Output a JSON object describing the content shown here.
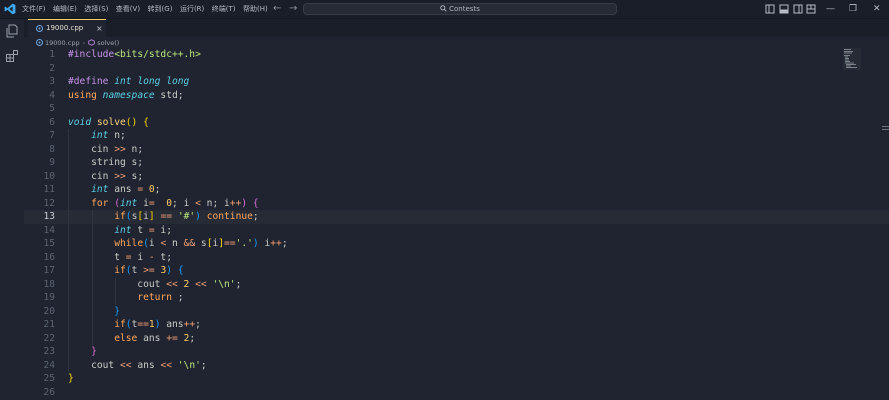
{
  "menu": [
    "文件(F)",
    "编辑(E)",
    "选择(S)",
    "查看(V)",
    "转到(G)",
    "运行(R)",
    "终端(T)",
    "帮助(H)"
  ],
  "search": {
    "label": "Contests"
  },
  "tab": {
    "filename": "19000.cpp",
    "close": "×"
  },
  "breadcrumb": {
    "file": "19000.cpp",
    "separator": "›",
    "symbol": "solve()"
  },
  "current_line": 13,
  "colors": {
    "accent": "#ffcc66",
    "background": "#1f2430"
  },
  "code": [
    {
      "n": "1",
      "t": [
        {
          "c": "t-pre",
          "v": "#include"
        },
        {
          "c": "t-inc",
          "v": "<bits/stdc++.h>"
        }
      ]
    },
    {
      "n": "2",
      "t": []
    },
    {
      "n": "3",
      "t": [
        {
          "c": "t-pre",
          "v": "#define "
        },
        {
          "c": "t-type",
          "v": "int"
        },
        {
          "c": "",
          "v": " "
        },
        {
          "c": "t-type",
          "v": "long long"
        }
      ]
    },
    {
      "n": "4",
      "t": [
        {
          "c": "t-kw",
          "v": "using"
        },
        {
          "c": "",
          "v": " "
        },
        {
          "c": "t-type",
          "v": "namespace"
        },
        {
          "c": "",
          "v": " std;"
        }
      ]
    },
    {
      "n": "5",
      "t": []
    },
    {
      "n": "6",
      "t": [
        {
          "c": "t-type",
          "v": "void"
        },
        {
          "c": "",
          "v": " "
        },
        {
          "c": "t-fn",
          "v": "solve"
        },
        {
          "c": "t-br1",
          "v": "()"
        },
        {
          "c": "",
          "v": " "
        },
        {
          "c": "t-br1",
          "v": "{"
        }
      ]
    },
    {
      "n": "7",
      "t": [
        {
          "c": "",
          "v": "    "
        },
        {
          "c": "t-type",
          "v": "int"
        },
        {
          "c": "",
          "v": " n;"
        }
      ]
    },
    {
      "n": "8",
      "t": [
        {
          "c": "",
          "v": "    cin "
        },
        {
          "c": "t-op",
          "v": ">>"
        },
        {
          "c": "",
          "v": " n;"
        }
      ]
    },
    {
      "n": "9",
      "t": [
        {
          "c": "",
          "v": "    string s;"
        }
      ]
    },
    {
      "n": "10",
      "t": [
        {
          "c": "",
          "v": "    cin "
        },
        {
          "c": "t-op",
          "v": ">>"
        },
        {
          "c": "",
          "v": " s;"
        }
      ]
    },
    {
      "n": "11",
      "t": [
        {
          "c": "",
          "v": "    "
        },
        {
          "c": "t-type",
          "v": "int"
        },
        {
          "c": "",
          "v": " ans "
        },
        {
          "c": "t-op",
          "v": "="
        },
        {
          "c": "",
          "v": " "
        },
        {
          "c": "t-num",
          "v": "0"
        },
        {
          "c": "",
          "v": ";"
        }
      ]
    },
    {
      "n": "12",
      "t": [
        {
          "c": "",
          "v": "    "
        },
        {
          "c": "t-kw",
          "v": "for"
        },
        {
          "c": "",
          "v": " "
        },
        {
          "c": "t-br2",
          "v": "("
        },
        {
          "c": "t-type",
          "v": "int"
        },
        {
          "c": "",
          "v": " i"
        },
        {
          "c": "t-op",
          "v": "="
        },
        {
          "c": "",
          "v": "  "
        },
        {
          "c": "t-num",
          "v": "0"
        },
        {
          "c": "",
          "v": "; i "
        },
        {
          "c": "t-op",
          "v": "<"
        },
        {
          "c": "",
          "v": " n; i"
        },
        {
          "c": "t-op",
          "v": "++"
        },
        {
          "c": "t-br2",
          "v": ")"
        },
        {
          "c": "",
          "v": " "
        },
        {
          "c": "t-br2",
          "v": "{"
        }
      ]
    },
    {
      "n": "13",
      "t": [
        {
          "c": "",
          "v": "        "
        },
        {
          "c": "t-kw",
          "v": "if"
        },
        {
          "c": "t-br3",
          "v": "("
        },
        {
          "c": "",
          "v": "s"
        },
        {
          "c": "t-br1",
          "v": "["
        },
        {
          "c": "",
          "v": "i"
        },
        {
          "c": "t-br1",
          "v": "]"
        },
        {
          "c": "",
          "v": " "
        },
        {
          "c": "t-op",
          "v": "=="
        },
        {
          "c": "",
          "v": " "
        },
        {
          "c": "t-str",
          "v": "'#'"
        },
        {
          "c": "t-br3",
          "v": ")"
        },
        {
          "c": "",
          "v": " "
        },
        {
          "c": "t-kw",
          "v": "continue"
        },
        {
          "c": "",
          "v": ";"
        }
      ]
    },
    {
      "n": "14",
      "t": [
        {
          "c": "",
          "v": "        "
        },
        {
          "c": "t-type",
          "v": "int"
        },
        {
          "c": "",
          "v": " t "
        },
        {
          "c": "t-op",
          "v": "="
        },
        {
          "c": "",
          "v": " i;"
        }
      ]
    },
    {
      "n": "15",
      "t": [
        {
          "c": "",
          "v": "        "
        },
        {
          "c": "t-kw",
          "v": "while"
        },
        {
          "c": "t-br3",
          "v": "("
        },
        {
          "c": "",
          "v": "i "
        },
        {
          "c": "t-op",
          "v": "<"
        },
        {
          "c": "",
          "v": " n "
        },
        {
          "c": "t-op",
          "v": "&&"
        },
        {
          "c": "",
          "v": " s"
        },
        {
          "c": "t-br1",
          "v": "["
        },
        {
          "c": "",
          "v": "i"
        },
        {
          "c": "t-br1",
          "v": "]"
        },
        {
          "c": "t-op",
          "v": "=="
        },
        {
          "c": "t-str",
          "v": "'.'"
        },
        {
          "c": "t-br3",
          "v": ")"
        },
        {
          "c": "",
          "v": " i"
        },
        {
          "c": "t-op",
          "v": "++"
        },
        {
          "c": "",
          "v": ";"
        }
      ]
    },
    {
      "n": "16",
      "t": [
        {
          "c": "",
          "v": "        t "
        },
        {
          "c": "t-op",
          "v": "="
        },
        {
          "c": "",
          "v": " i "
        },
        {
          "c": "t-op",
          "v": "-"
        },
        {
          "c": "",
          "v": " t;"
        }
      ]
    },
    {
      "n": "17",
      "t": [
        {
          "c": "",
          "v": "        "
        },
        {
          "c": "t-kw",
          "v": "if"
        },
        {
          "c": "t-br3",
          "v": "("
        },
        {
          "c": "",
          "v": "t "
        },
        {
          "c": "t-op",
          "v": ">="
        },
        {
          "c": "",
          "v": " "
        },
        {
          "c": "t-num",
          "v": "3"
        },
        {
          "c": "t-br3",
          "v": ")"
        },
        {
          "c": "",
          "v": " "
        },
        {
          "c": "t-br3",
          "v": "{"
        }
      ]
    },
    {
      "n": "18",
      "t": [
        {
          "c": "",
          "v": "            cout "
        },
        {
          "c": "t-op",
          "v": "<<"
        },
        {
          "c": "",
          "v": " "
        },
        {
          "c": "t-num",
          "v": "2"
        },
        {
          "c": "",
          "v": " "
        },
        {
          "c": "t-op",
          "v": "<<"
        },
        {
          "c": "",
          "v": " "
        },
        {
          "c": "t-str",
          "v": "'\\n'"
        },
        {
          "c": "",
          "v": ";"
        }
      ]
    },
    {
      "n": "19",
      "t": [
        {
          "c": "",
          "v": "            "
        },
        {
          "c": "t-kw",
          "v": "return"
        },
        {
          "c": "",
          "v": " ;"
        }
      ]
    },
    {
      "n": "20",
      "t": [
        {
          "c": "",
          "v": "        "
        },
        {
          "c": "t-br3",
          "v": "}"
        }
      ]
    },
    {
      "n": "21",
      "t": [
        {
          "c": "",
          "v": "        "
        },
        {
          "c": "t-kw",
          "v": "if"
        },
        {
          "c": "t-br3",
          "v": "("
        },
        {
          "c": "",
          "v": "t"
        },
        {
          "c": "t-op",
          "v": "=="
        },
        {
          "c": "t-num",
          "v": "1"
        },
        {
          "c": "t-br3",
          "v": ")"
        },
        {
          "c": "",
          "v": " ans"
        },
        {
          "c": "t-op",
          "v": "++"
        },
        {
          "c": "",
          "v": ";"
        }
      ]
    },
    {
      "n": "22",
      "t": [
        {
          "c": "",
          "v": "        "
        },
        {
          "c": "t-kw",
          "v": "else"
        },
        {
          "c": "",
          "v": " ans "
        },
        {
          "c": "t-op",
          "v": "+="
        },
        {
          "c": "",
          "v": " "
        },
        {
          "c": "t-num",
          "v": "2"
        },
        {
          "c": "",
          "v": ";"
        }
      ]
    },
    {
      "n": "23",
      "t": [
        {
          "c": "",
          "v": "    "
        },
        {
          "c": "t-br2",
          "v": "}"
        }
      ]
    },
    {
      "n": "24",
      "t": [
        {
          "c": "",
          "v": "    cout "
        },
        {
          "c": "t-op",
          "v": "<<"
        },
        {
          "c": "",
          "v": " ans "
        },
        {
          "c": "t-op",
          "v": "<<"
        },
        {
          "c": "",
          "v": " "
        },
        {
          "c": "t-str",
          "v": "'\\n'"
        },
        {
          "c": "",
          "v": ";"
        }
      ]
    },
    {
      "n": "25",
      "t": [
        {
          "c": "t-br1",
          "v": "}"
        }
      ]
    },
    {
      "n": "26",
      "t": []
    }
  ]
}
